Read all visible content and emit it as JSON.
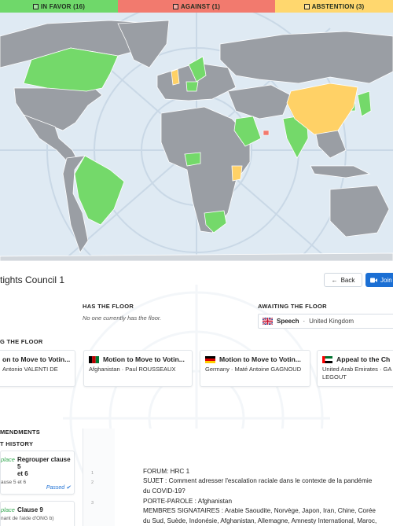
{
  "vote_bar": {
    "in_favor": "IN FAVOR (16)",
    "against": "AGAINST (1)",
    "abstention": "ABSTENTION (3)",
    "colors": {
      "in_favor": "#6fd86a",
      "against": "#f27a6e",
      "abstention": "#ffd76e"
    }
  },
  "map": {
    "land_color": "#9a9ea4",
    "ocean_color": "#dfeaf3",
    "in_favor_color": "#74d96a",
    "abstention_color": "#ffd166",
    "against_color": "#f27a6e"
  },
  "session": {
    "title": "tights Council 1",
    "back_label": "Back",
    "join_label": "Join"
  },
  "has_floor": {
    "heading": "HAS THE FLOOR",
    "empty_text": "No one currently has the floor."
  },
  "awaiting_floor": {
    "heading": "AWAITING THE FLOOR",
    "type": "Speech",
    "separator": "·",
    "delegation": "United Kingdom"
  },
  "asking_floor": {
    "heading": "G THE FLOOR",
    "requests": [
      {
        "title": "on to Move to Votin...",
        "subtitle": "Antonio VALENTI DE"
      },
      {
        "title": "Motion to Move to Votin...",
        "subtitle": "Afghanistan · Paul ROUSSEAUX"
      },
      {
        "title": "Motion to Move to Votin...",
        "subtitle": "Germany · Maté Antoine GAGNOUD"
      },
      {
        "title": "Appeal to the Ch",
        "subtitle": "United Arab Emirates · GA",
        "subtitle2": "LEGOUT"
      }
    ]
  },
  "amendments": {
    "heading": "MENDMENTS",
    "history_heading": "T HISTORY",
    "items": [
      {
        "verb": "place",
        "name": "Regrouper clause 5",
        "name2": "et 6",
        "sub": "ause 5 et 6",
        "status": "Passed"
      },
      {
        "verb": "place",
        "name": "Clause 9",
        "sub": "nant de l'aide d'ONG b)"
      }
    ]
  },
  "document": {
    "line_numbers": [
      "1",
      "2",
      "3"
    ],
    "lines": [
      "FORUM: HRC 1",
      "SUJET : Comment adresser l'escalation raciale dans le contexte de la pandémie",
      "du COVID-19?",
      "PORTE-PAROLE : Afghanistan",
      "MEMBRES SIGNATAIRES : Arabie Saoudite, Norvège, Japon, Iran, Chine, Corée",
      "du Sud, Suède, Indonésie, Afghanistan, Allemagne, Amnesty International, Maroc,"
    ]
  }
}
